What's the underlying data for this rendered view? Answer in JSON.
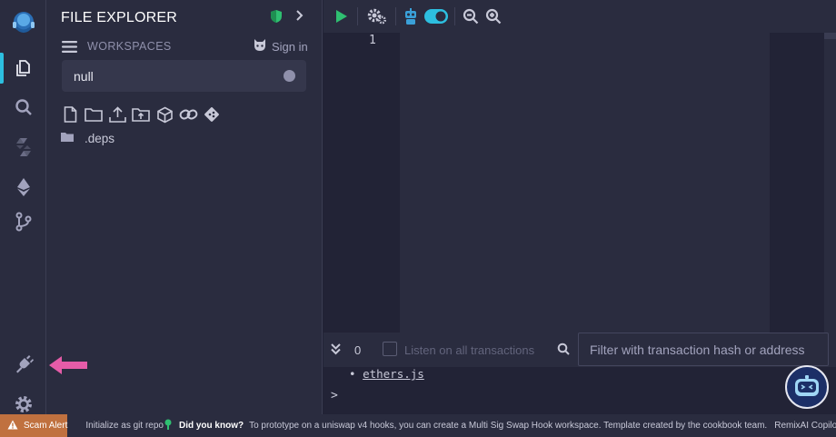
{
  "side_panel": {
    "title": "FILE EXPLORER",
    "workspaces_label": "WORKSPACES",
    "sign_in_label": "Sign in",
    "workspace_selected": "null",
    "tree": [
      {
        "type": "folder",
        "label": ".deps"
      }
    ]
  },
  "editor": {
    "line_numbers": [
      "1"
    ]
  },
  "terminal": {
    "tx_count": "0",
    "listen_label": "Listen on all transactions",
    "filter_placeholder": "Filter with transaction hash or address",
    "output_link": "ethers.js",
    "prompt": ">"
  },
  "status_bar": {
    "scam_alert": "Scam Alert",
    "git_label": "Initialize as git repo",
    "did_you_know": "Did you know?",
    "tip": "To prototype on a uniswap v4 hooks, you can create a Multi Sig Swap Hook workspace. Template created by the cookbook team.",
    "ai_label": "RemixAI Copilot"
  },
  "colors": {
    "accent": "#2dbfe0",
    "run_green": "#2fbf71",
    "toggle_teal": "#2dbfe0",
    "shield_green": "#2fbf71",
    "scam_orange": "#c0713f",
    "annotation_pink": "#e55ca8"
  },
  "icons": [
    "remix-logo-icon",
    "file-explorer-icon",
    "search-icon",
    "solidity-compiler-icon",
    "deploy-icon",
    "git-icon",
    "plugin-manager-icon",
    "settings-icon",
    "shield-icon",
    "chevron-right-icon",
    "hamburger-icon",
    "github-icon",
    "new-file-icon",
    "new-folder-icon",
    "upload-file-icon",
    "upload-folder-icon",
    "workspace-box-icon",
    "link-icon",
    "git-branch-icon",
    "folder-icon",
    "play-icon",
    "gear-icon",
    "robot-icon",
    "toggle-icon",
    "zoom-out-icon",
    "zoom-in-icon",
    "double-chevron-down-icon",
    "warning-icon",
    "arrow-left-icon"
  ]
}
